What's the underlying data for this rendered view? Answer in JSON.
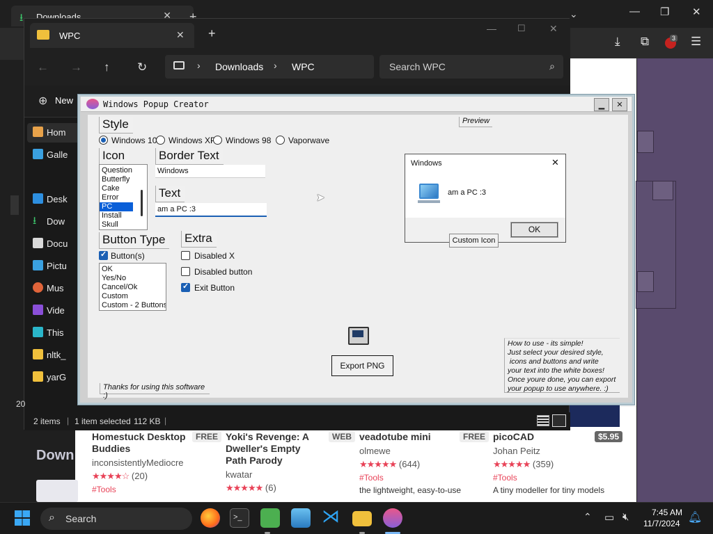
{
  "browser": {
    "tab_label": "Downloads",
    "extension_badge": "3"
  },
  "explorer": {
    "tab_label": "WPC",
    "breadcrumb": [
      "Downloads",
      "WPC"
    ],
    "search_placeholder": "Search WPC",
    "new_label": "New",
    "sidebar": [
      "Hom",
      "Galle",
      "Desk",
      "Dow",
      "Docu",
      "Pictu",
      "Mus",
      "Vide",
      "This",
      "nltk_",
      "yarG"
    ],
    "status_left_fragment": "20",
    "status": {
      "items": "2 items",
      "selected": "1 item selected",
      "size": "112 KB"
    }
  },
  "wpc": {
    "title": "Windows Popup Creator",
    "style_heading": "Style",
    "styles": [
      "Windows 10",
      "Windows XP",
      "Windows 98",
      "Vaporwave"
    ],
    "icon_heading": "Icon",
    "icons": [
      "Question",
      "Butterfly",
      "Cake",
      "Error",
      "PC",
      "Install",
      "Skull"
    ],
    "icon_selected": "PC",
    "border_text_heading": "Border Text",
    "border_text_value": "Windows",
    "text_heading": "Text",
    "text_value": "am a PC :3",
    "button_type_heading": "Button Type",
    "buttons_checkbox": "Button(s)",
    "button_options": [
      "OK",
      "Yes/No",
      "Cancel/Ok",
      "Custom",
      "Custom - 2 Buttons"
    ],
    "extra_heading": "Extra",
    "extras": [
      {
        "label": "Disabled X",
        "checked": false
      },
      {
        "label": "Disabled button",
        "checked": false
      },
      {
        "label": "Exit Button",
        "checked": true
      }
    ],
    "preview_label": "Preview",
    "preview": {
      "title": "Windows",
      "message": "am a PC :3",
      "ok": "OK"
    },
    "custom_icon_button": "Custom Icon",
    "export_button": "Export PNG",
    "thanks": "Thanks for using this software :)",
    "howto": "How to use - its simple!\nJust select your desired style,\n icons and buttons and write\nyour text into the white boxes!\nOnce youre done, you can export\nyour popup to use anywhere. :)"
  },
  "store": {
    "faded_heading": "Down",
    "cards": [
      {
        "title": "Homestuck Desktop Buddies",
        "price": "FREE",
        "author": "inconsistentlyMediocre",
        "stars": "★★★★☆",
        "count": "(20)",
        "tag": "#Tools",
        "desc": ""
      },
      {
        "title": "Yoki's Revenge: A Dweller's Empty Path Parody",
        "price": "WEB",
        "author": "kwatar",
        "stars": "★★★★★",
        "count": "(6)",
        "tag": "",
        "desc": ""
      },
      {
        "title": "veadotube mini",
        "price": "FREE",
        "author": "olmewe",
        "stars": "★★★★★",
        "count": "(644)",
        "tag": "#Tools",
        "desc": "the lightweight, easy-to-use"
      },
      {
        "title": "picoCAD",
        "price": "$5.95",
        "author": "Johan Peitz",
        "stars": "★★★★★",
        "count": "(359)",
        "tag": "#Tools",
        "desc": "A tiny modeller for tiny models"
      }
    ]
  },
  "taskbar": {
    "search_label": "Search",
    "time": "7:45 AM",
    "date": "11/7/2024"
  }
}
